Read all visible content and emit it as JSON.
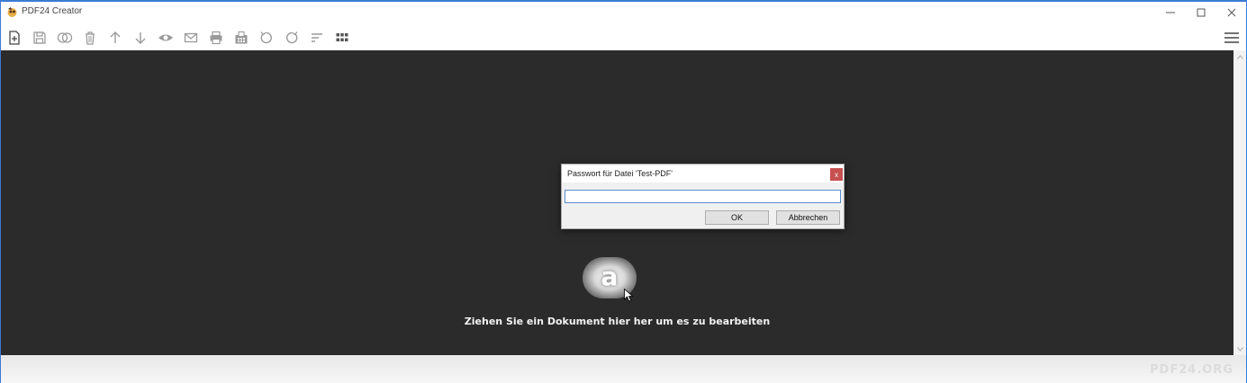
{
  "window": {
    "title": "PDF24 Creator"
  },
  "toolbar": {
    "items": [
      {
        "name": "new-file-icon"
      },
      {
        "name": "save-icon"
      },
      {
        "name": "merge-icon"
      },
      {
        "name": "delete-icon"
      },
      {
        "name": "move-up-icon"
      },
      {
        "name": "move-down-icon"
      },
      {
        "name": "preview-icon"
      },
      {
        "name": "email-icon"
      },
      {
        "name": "print-icon"
      },
      {
        "name": "fax-icon"
      },
      {
        "name": "rotate-left-icon"
      },
      {
        "name": "rotate-right-icon"
      },
      {
        "name": "sort-icon"
      },
      {
        "name": "grid-view-icon"
      }
    ],
    "menu_icon": "hamburger-menu-icon"
  },
  "workspace": {
    "drop_hint": "Ziehen Sie ein Dokument hier her um es zu bearbeiten",
    "logo_letter": "a"
  },
  "dialog": {
    "title": "Passwort für Datei 'Test-PDF'",
    "close_label": "x",
    "password_value": "",
    "ok_label": "OK",
    "cancel_label": "Abbrechen"
  },
  "footer": {
    "brand": "PDF24.ORG"
  },
  "colors": {
    "workspace_bg": "#2b2b2b",
    "icon_gray": "#9a9a9a",
    "icon_dark": "#555555",
    "close_red": "#c75050",
    "window_border": "#3a7bd5"
  }
}
